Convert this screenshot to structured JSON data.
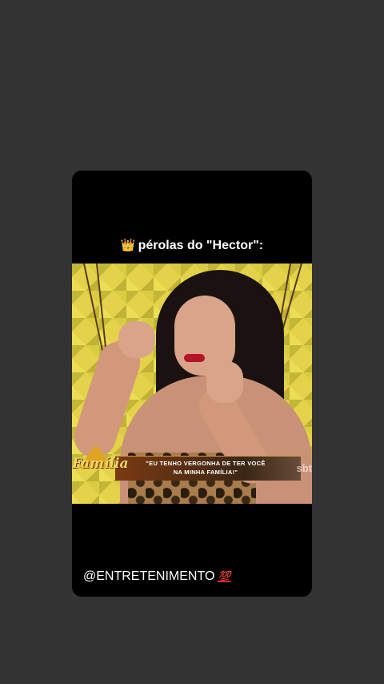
{
  "story": {
    "caption_top_emoji": "👑",
    "caption_top_text": "pérolas do \"Hector\":",
    "caption_bottom_text": "@ENTRETENIMENTO",
    "caption_bottom_emoji": "💯"
  },
  "video": {
    "show_logo_text": "Família",
    "lower_third_line1": "\"EU TENHO VERGONHA DE TER VOCÊ",
    "lower_third_line2": "NA MINHA FAMÍLIA!\"",
    "watermark": "sbt"
  }
}
